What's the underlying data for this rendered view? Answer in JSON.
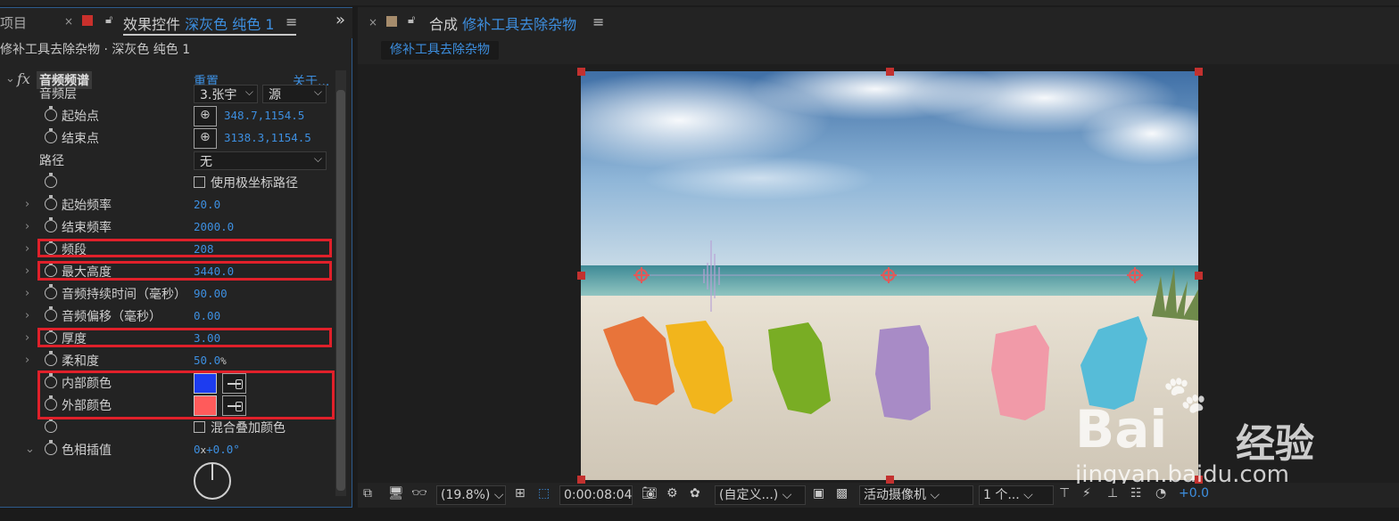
{
  "left_panel": {
    "project_tab": "项目",
    "close": "×",
    "title_prefix": "效果控件",
    "title_layer": "深灰色 纯色 1",
    "menu": "≡",
    "expand": "»",
    "subheader": "修补工具去除杂物 · 深灰色 纯色 1",
    "effect": {
      "name": "音频频谱",
      "reset": "重置",
      "about": "关于..."
    },
    "props": {
      "audio_layer": {
        "label": "音频层",
        "layer": "3.张宇",
        "source": "源"
      },
      "start_point": {
        "label": "起始点",
        "value": "348.7,1154.5"
      },
      "end_point": {
        "label": "结束点",
        "value": "3138.3,1154.5"
      },
      "path": {
        "label": "路径",
        "value": "无"
      },
      "polar": {
        "label": "使用极坐标路径"
      },
      "start_freq": {
        "label": "起始频率",
        "value": "20.0"
      },
      "end_freq": {
        "label": "结束频率",
        "value": "2000.0"
      },
      "bands": {
        "label": "频段",
        "value": "208"
      },
      "max_height": {
        "label": "最大高度",
        "value": "3440.0"
      },
      "audio_duration": {
        "label": "音频持续时间（毫秒）",
        "value": "90.00"
      },
      "audio_offset": {
        "label": "音频偏移（毫秒）",
        "value": "0.00"
      },
      "thickness": {
        "label": "厚度",
        "value": "3.00"
      },
      "softness": {
        "label": "柔和度",
        "value": "50.0",
        "unit": "%"
      },
      "inside_color": {
        "label": "内部颜色",
        "color": "#1d3cf0"
      },
      "outside_color": {
        "label": "外部颜色",
        "color": "#ff5b5b"
      },
      "blend": {
        "label": "混合叠加颜色"
      },
      "hue_interp": {
        "label": "色相插值",
        "value_a": "0",
        "unit_x": "x",
        "value_b": "+0.0°"
      }
    }
  },
  "right_panel": {
    "close": "×",
    "title_prefix": "合成",
    "title_comp": "修补工具去除杂物",
    "menu": "≡",
    "breadcrumb": "修补工具去除杂物"
  },
  "toolbar": {
    "zoom": "(19.8%)",
    "timecode": "0:00:08:04",
    "resolution": "(自定义...)",
    "camera": "活动摄像机",
    "views": "1 个...",
    "exposure": "+0.0"
  },
  "watermark": {
    "brand": "Bai",
    "brand_suffix": "经验",
    "url": "jingyan.baidu.com"
  },
  "colors": {
    "accent": "#3d8fe0",
    "highlight_box": "#e0202a",
    "panel_bg": "#232323"
  }
}
